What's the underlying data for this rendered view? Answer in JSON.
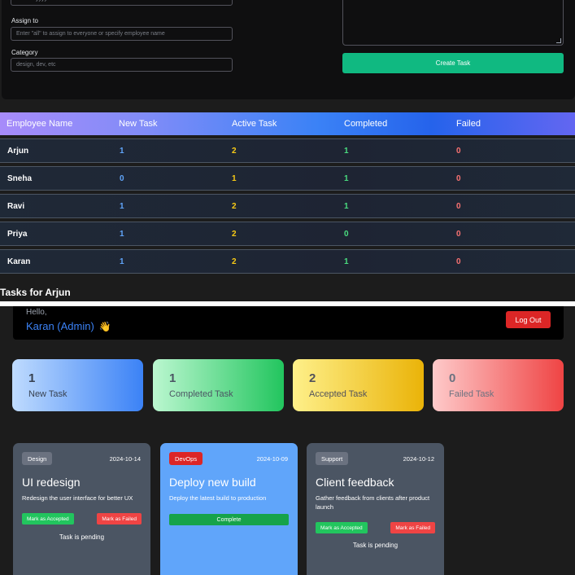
{
  "admin_form": {
    "date_value": "dd-mm-yyyy",
    "assign_label": "Assign to",
    "assign_placeholder": "Enter \"all\" to assign to everyone or specify employee name",
    "category_label": "Category",
    "category_placeholder": "design, dev, etc",
    "create_button": "Create Task"
  },
  "employee_table": {
    "headers": [
      "Employee Name",
      "New Task",
      "Active Task",
      "Completed",
      "Failed"
    ],
    "rows": [
      {
        "name": "Arjun",
        "new": "1",
        "active": "2",
        "completed": "1",
        "failed": "0"
      },
      {
        "name": "Sneha",
        "new": "0",
        "active": "1",
        "completed": "1",
        "failed": "0"
      },
      {
        "name": "Ravi",
        "new": "1",
        "active": "2",
        "completed": "1",
        "failed": "0"
      },
      {
        "name": "Priya",
        "new": "1",
        "active": "2",
        "completed": "0",
        "failed": "0"
      },
      {
        "name": "Karan",
        "new": "1",
        "active": "2",
        "completed": "1",
        "failed": "0"
      }
    ]
  },
  "tasks_heading": "Tasks for Arjun",
  "dashboard": {
    "greeting": "Hello,",
    "user_name": "Karan (Admin)",
    "wave_icon": "👋",
    "logout_label": "Log Out",
    "stats": [
      {
        "count": "1",
        "label": "New Task"
      },
      {
        "count": "1",
        "label": "Completed Task"
      },
      {
        "count": "2",
        "label": "Accepted Task"
      },
      {
        "count": "0",
        "label": "Failed Task"
      }
    ],
    "tasks": [
      {
        "category": "Design",
        "date": "2024-10-14",
        "title": "UI redesign",
        "description": "Redesign the user interface for better UX",
        "accept_label": "Mark as Accepted",
        "fail_label": "Mark as Failed",
        "status": "Task is pending"
      },
      {
        "category": "DevOps",
        "date": "2024-10-09",
        "title": "Deploy new build",
        "description": "Deploy the latest build to production",
        "complete_label": "Complete"
      },
      {
        "category": "Support",
        "date": "2024-10-12",
        "title": "Client feedback",
        "description": "Gather feedback from clients after product launch",
        "accept_label": "Mark as Accepted",
        "fail_label": "Mark as Failed",
        "status": "Task is pending"
      }
    ]
  },
  "colors": {
    "accent_green": "#10b981",
    "logout_red": "#dc2626",
    "name_blue": "#3b82f6"
  }
}
